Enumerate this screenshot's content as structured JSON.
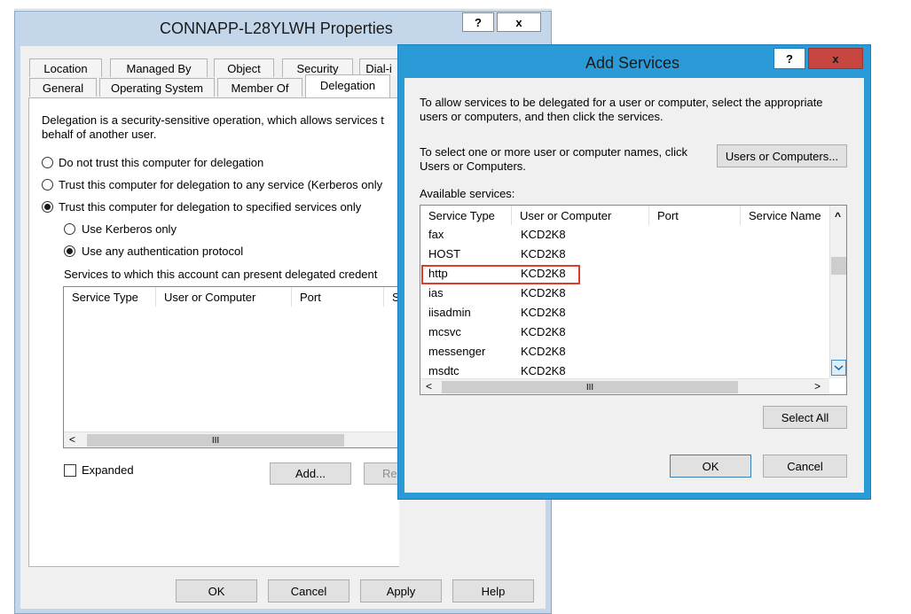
{
  "properties": {
    "title": "CONNAPP-L28YLWH Properties",
    "help_glyph": "?",
    "close_glyph": "x",
    "tabs_row1": [
      "Location",
      "Managed By",
      "Object",
      "Security",
      "Dial-i"
    ],
    "tabs_row2": [
      "General",
      "Operating System",
      "Member Of",
      "Delegation"
    ],
    "description": "Delegation is a security-sensitive operation, which allows services t behalf of another user.",
    "description_line1": "Delegation is a security-sensitive operation, which allows services t",
    "description_line2": "behalf of another user.",
    "radio_no_trust": "Do not trust this computer for delegation",
    "radio_any_service": "Trust this computer for delegation to any service (Kerberos only",
    "radio_specified": "Trust this computer for delegation to specified services only",
    "radio_kerberos_only": "Use Kerberos only",
    "radio_any_protocol": "Use any authentication protocol",
    "services_label": "Services to which this account can present delegated credent",
    "columns": [
      "Service Type",
      "User or Computer",
      "Port",
      "S"
    ],
    "hscroll_left": "<",
    "hscroll_thumb": "III",
    "expanded_label": "Expanded",
    "add_button": "Add...",
    "remove_button": "Re",
    "ok_button": "OK",
    "cancel_button": "Cancel",
    "apply_button": "Apply",
    "help_button": "Help"
  },
  "add_services": {
    "title": "Add Services",
    "help_glyph": "?",
    "close_glyph": "x",
    "instructions_line1": "To allow services to be delegated for a user or computer, select the appropriate",
    "instructions_line2": "users or computers, and then click the services.",
    "select_line1": "To select one or more user or computer names, click",
    "select_line2": "Users or Computers.",
    "users_computers_button": "Users or Computers...",
    "available_label": "Available services:",
    "columns": [
      "Service Type",
      "User or Computer",
      "Port",
      "Service Name"
    ],
    "services": [
      {
        "type": "fax",
        "computer": "KCD2K8"
      },
      {
        "type": "HOST",
        "computer": "KCD2K8"
      },
      {
        "type": "http",
        "computer": "KCD2K8"
      },
      {
        "type": "ias",
        "computer": "KCD2K8"
      },
      {
        "type": "iisadmin",
        "computer": "KCD2K8"
      },
      {
        "type": "mcsvc",
        "computer": "KCD2K8"
      },
      {
        "type": "messenger",
        "computer": "KCD2K8"
      },
      {
        "type": "msdtc",
        "computer": "KCD2K8"
      }
    ],
    "highlighted_service": "http",
    "scroll_up": "^",
    "scroll_left": "<",
    "scroll_right": ">",
    "scroll_thumb": "III",
    "select_all_button": "Select All",
    "ok_button": "OK",
    "cancel_button": "Cancel"
  },
  "colors": {
    "dialog_border": "#2b9bd8",
    "highlight": "#e03a2a",
    "close_button": "#c7463f"
  }
}
